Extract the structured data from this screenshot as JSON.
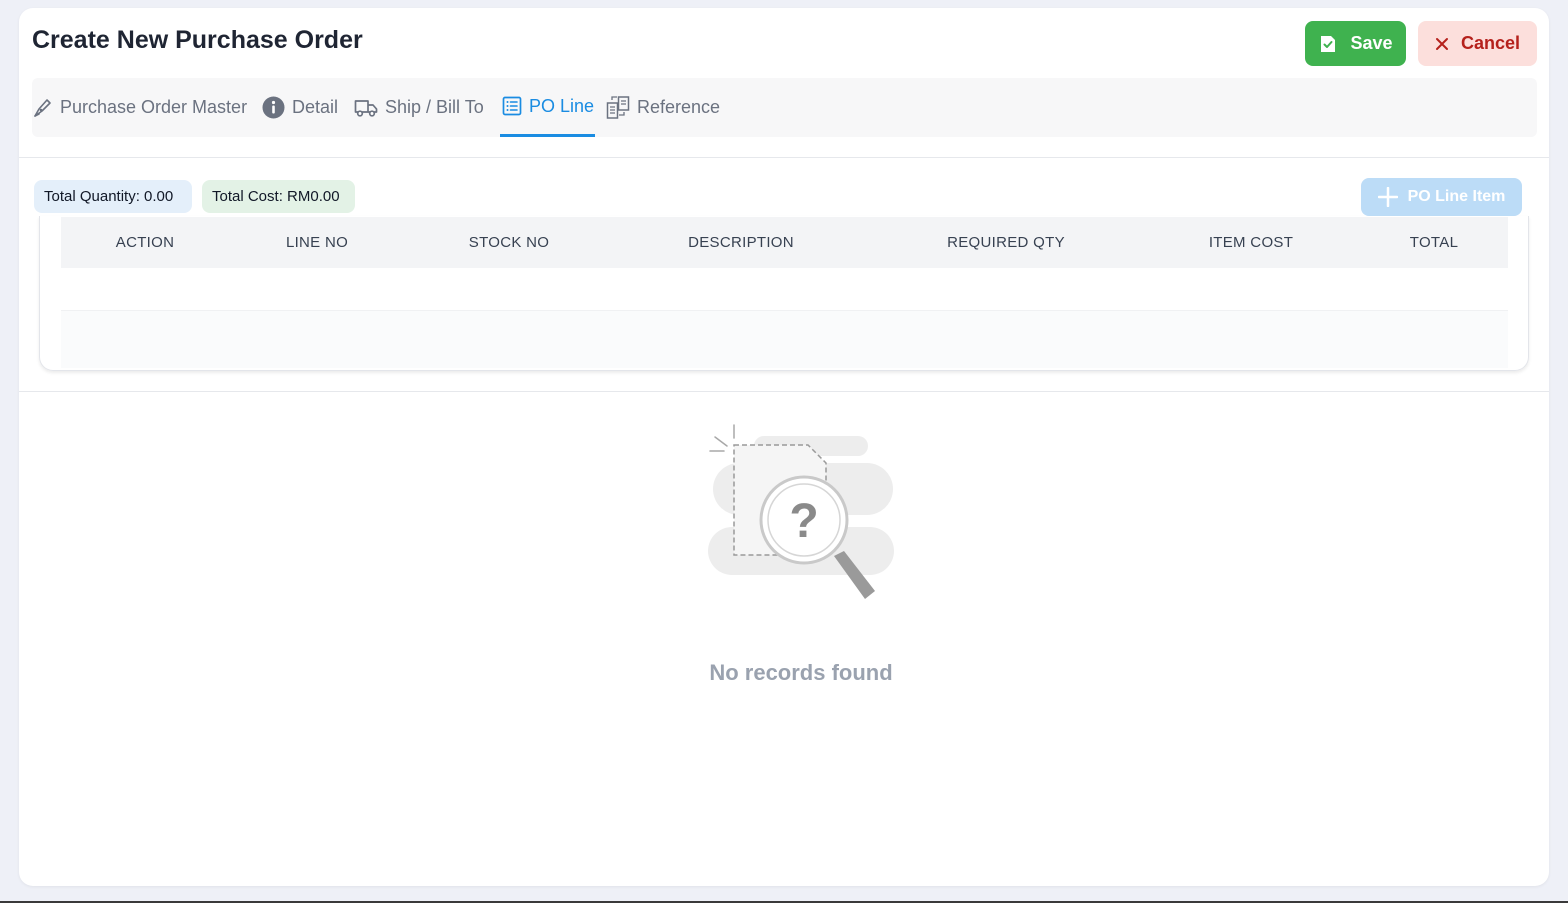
{
  "header": {
    "title": "Create New Purchase Order",
    "save_label": "Save",
    "cancel_label": "Cancel"
  },
  "tabs": [
    {
      "label": "Purchase Order Master",
      "icon": "pen-nib-icon"
    },
    {
      "label": "Detail",
      "icon": "info-icon"
    },
    {
      "label": "Ship / Bill To",
      "icon": "truck-icon"
    },
    {
      "label": "PO Line",
      "icon": "list-icon",
      "active": true
    },
    {
      "label": "Reference",
      "icon": "documents-icon"
    }
  ],
  "summary": {
    "total_quantity": "Total Quantity: 0.00",
    "total_cost": "Total Cost: RM0.00"
  },
  "add_button_label": "PO Line Item",
  "table": {
    "columns": [
      "ACTION",
      "LINE NO",
      "STOCK NO",
      "DESCRIPTION",
      "REQUIRED QTY",
      "ITEM COST",
      "TOTAL"
    ],
    "rows": []
  },
  "empty_state": {
    "message": "No records found",
    "icon": "magnifier-question-icon"
  },
  "colors": {
    "accent": "#1a8ce2",
    "save": "#3fb24f",
    "cancel_bg": "#fcdfdc",
    "cancel_text": "#b5211c",
    "add_button": "#bcdcf7"
  }
}
